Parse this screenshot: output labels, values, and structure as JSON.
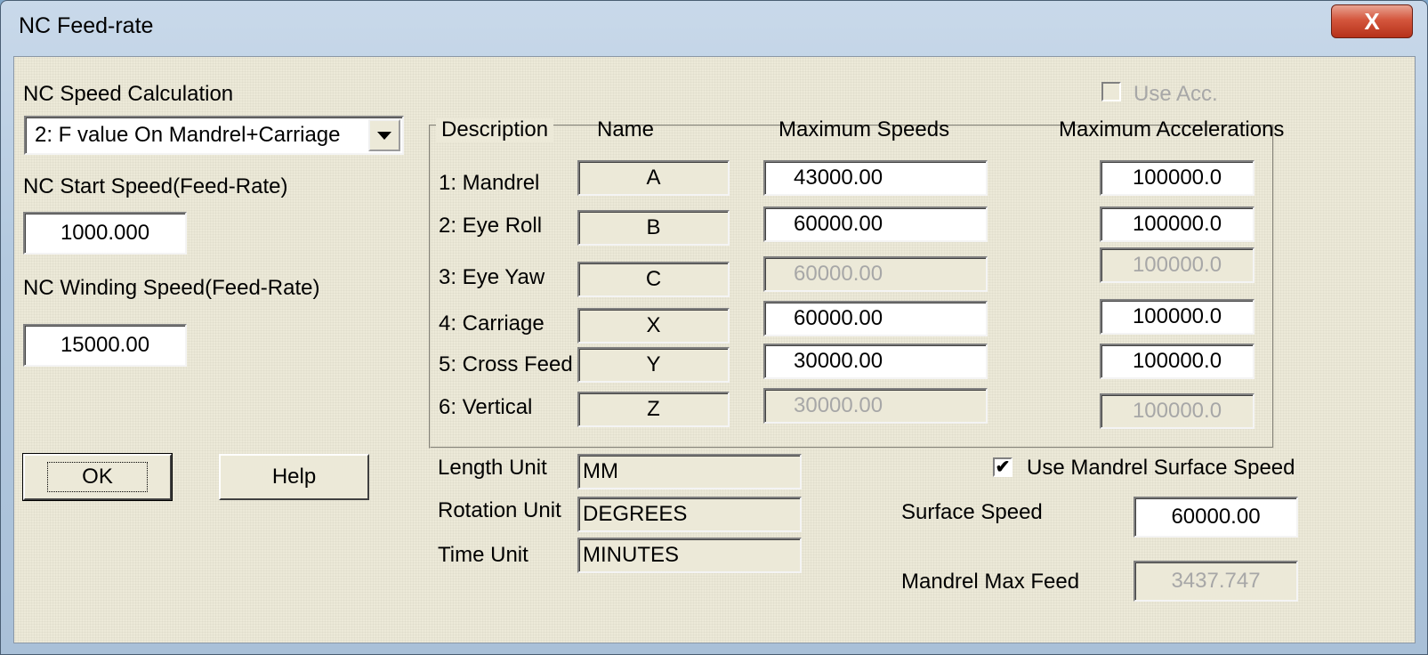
{
  "window": {
    "title": "NC Feed-rate",
    "close_glyph": "X"
  },
  "left": {
    "speed_calc_label": "NC Speed Calculation",
    "speed_calc_value": "2: F value On Mandrel+Carriage",
    "start_speed_label": "NC Start Speed(Feed-Rate)",
    "start_speed_value": "1000.000",
    "winding_speed_label": "NC Winding Speed(Feed-Rate)",
    "winding_speed_value": "15000.00",
    "ok_label": "OK",
    "help_label": "Help"
  },
  "axes": {
    "use_acc_label": "Use Acc.",
    "use_acc_checked": false,
    "headers": {
      "description": "Description",
      "name": "Name",
      "max_speeds": "Maximum Speeds",
      "max_accels": "Maximum Accelerations"
    },
    "rows": [
      {
        "description": "1: Mandrel",
        "name": "A",
        "speed": "43000.00",
        "accel": "100000.0",
        "enabled": true
      },
      {
        "description": "2: Eye Roll",
        "name": "B",
        "speed": "60000.00",
        "accel": "100000.0",
        "enabled": true
      },
      {
        "description": "3: Eye Yaw",
        "name": "C",
        "speed": "60000.00",
        "accel": "100000.0",
        "enabled": false
      },
      {
        "description": "4: Carriage",
        "name": "X",
        "speed": "60000.00",
        "accel": "100000.0",
        "enabled": true
      },
      {
        "description": "5: Cross Feed",
        "name": "Y",
        "speed": "30000.00",
        "accel": "100000.0",
        "enabled": true
      },
      {
        "description": "6: Vertical",
        "name": "Z",
        "speed": "30000.00",
        "accel": "100000.0",
        "enabled": false
      }
    ]
  },
  "units": {
    "length_label": "Length Unit",
    "length_value": "MM",
    "rotation_label": "Rotation Unit",
    "rotation_value": "DEGREES",
    "time_label": "Time Unit",
    "time_value": "MINUTES"
  },
  "surface": {
    "use_mandrel_label": "Use Mandrel Surface Speed",
    "use_mandrel_checked": true,
    "check_glyph": "✔",
    "surface_speed_label": "Surface Speed",
    "surface_speed_value": "60000.00",
    "mandrel_max_feed_label": "Mandrel Max Feed",
    "mandrel_max_feed_value": "3437.747"
  }
}
